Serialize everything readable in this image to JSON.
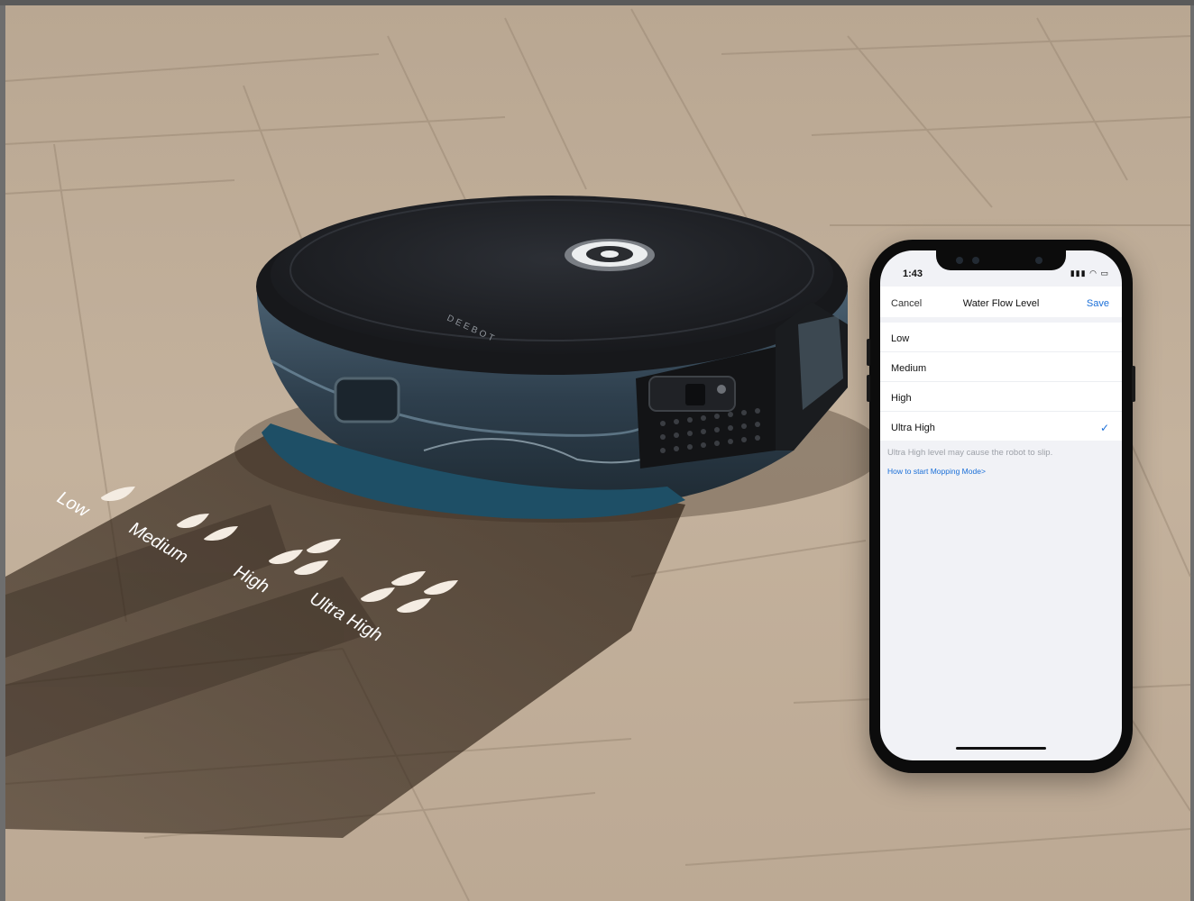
{
  "robot": {
    "brand": "DEEBOT"
  },
  "floor_labels": {
    "levels": [
      {
        "label": "Low",
        "drops": 1
      },
      {
        "label": "Medium",
        "drops": 2
      },
      {
        "label": "High",
        "drops": 3
      },
      {
        "label": "Ultra High",
        "drops": 4
      }
    ]
  },
  "phone": {
    "status": {
      "time": "1:43",
      "icons": "signal-icon wifi-icon battery-icon"
    },
    "nav": {
      "cancel_label": "Cancel",
      "title": "Water Flow Level",
      "save_label": "Save"
    },
    "options": [
      {
        "label": "Low",
        "selected": false
      },
      {
        "label": "Medium",
        "selected": false
      },
      {
        "label": "High",
        "selected": false
      },
      {
        "label": "Ultra High",
        "selected": true
      }
    ],
    "note": "Ultra High level may cause the robot to slip.",
    "link": "How to start Mopping Mode>"
  },
  "colors": {
    "accent": "#1a6fd8",
    "floor_base": "#c7b5a0",
    "robot_body": "#1b1d21"
  }
}
